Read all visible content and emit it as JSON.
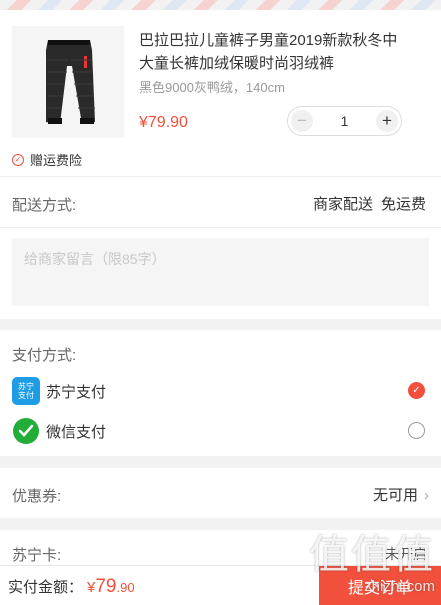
{
  "product": {
    "name": "巴拉巴拉儿童裤子男童2019新款秋冬中大童长裤加绒保暖时尚羽绒裤",
    "spec": "黑色9000灰鸭绒，140cm",
    "price": "¥79.90",
    "quantity": "1",
    "minus": "−",
    "plus": "+",
    "insurance": "赠运费险"
  },
  "delivery": {
    "label": "配送方式:",
    "method": "商家配送",
    "fee": "免运费"
  },
  "message": {
    "placeholder": "给商家留言（限85字）"
  },
  "payment": {
    "label": "支付方式:",
    "options": [
      {
        "name": "苏宁支付",
        "logo_text": "苏宁支付",
        "selected": true
      },
      {
        "name": "微信支付",
        "selected": false
      }
    ]
  },
  "coupon": {
    "label": "优惠券:",
    "value": "无可用"
  },
  "suning_card": {
    "label": "苏宁卡:",
    "value": "未开启"
  },
  "footer": {
    "total_label": "实付金额：",
    "currency": "¥",
    "amount_int": "79",
    "amount_dec": ".90",
    "submit": "提交订单"
  },
  "watermark": {
    "line1": "值值值",
    "line2": "zhizhi.com"
  },
  "colors": {
    "accent": "#f0503c",
    "suning_blue": "#1e9de5",
    "wechat_green": "#22ac38"
  }
}
